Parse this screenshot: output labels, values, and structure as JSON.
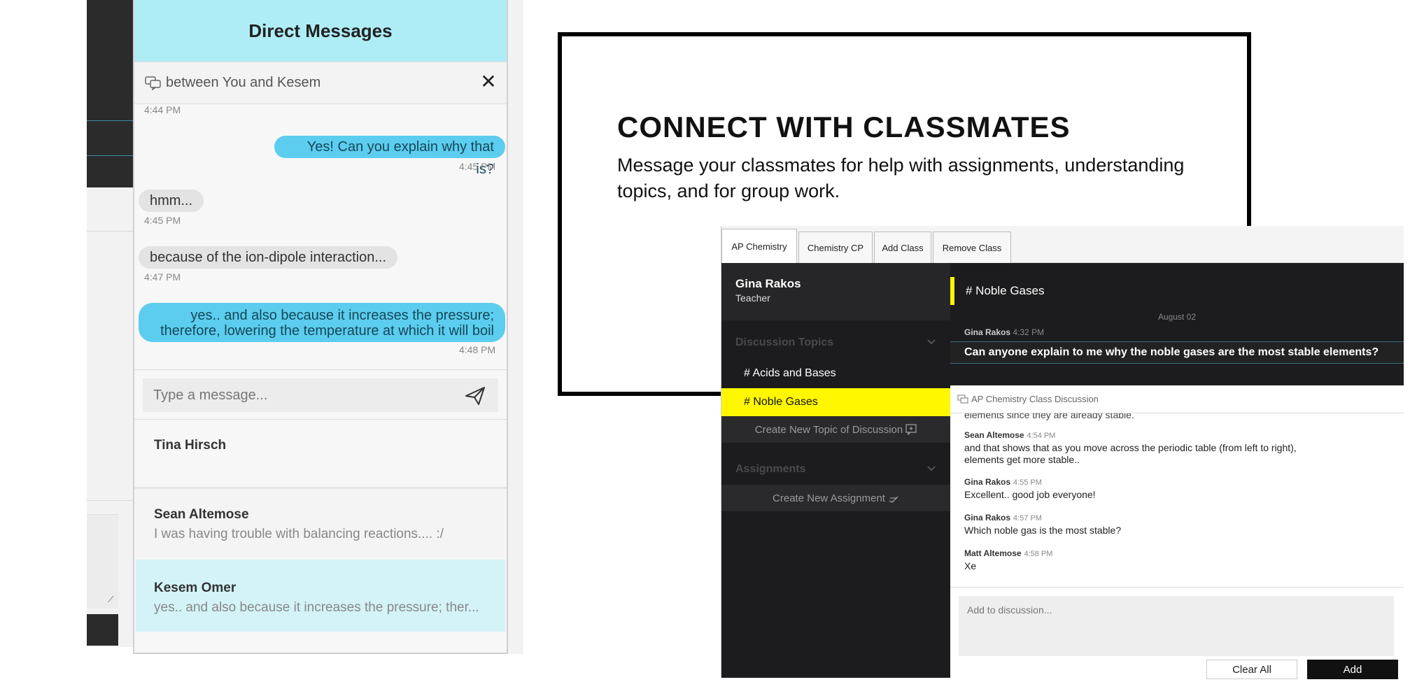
{
  "dm": {
    "title": "Direct Messages",
    "subtitle": "between You and Kesem",
    "messages": [
      {
        "time": "4:44 PM"
      },
      {
        "text": "Yes! Can you explain why that is?",
        "time": "4:45 PM",
        "from": "me"
      },
      {
        "text": "hmm...",
        "time": "4:45 PM",
        "from": "them"
      },
      {
        "text": "because of the ion-dipole interaction...",
        "time": "4:47 PM",
        "from": "them"
      },
      {
        "text_line1": "yes.. and also because it increases the pressure;",
        "text_line2": "therefore, lowering the temperature at which it will boil",
        "time": "4:48 PM",
        "from": "me"
      }
    ],
    "compose_placeholder": "Type a message...",
    "contacts": [
      {
        "name": "Tina Hirsch",
        "preview": ""
      },
      {
        "name": "Sean Altemose",
        "preview": "I was having trouble with balancing reactions.... :/"
      },
      {
        "name": "Kesem Omer",
        "preview": "yes.. and also because it increases the pressure; ther..."
      }
    ],
    "colors": {
      "header": "#aeedf6",
      "my_bubble": "#5ccdee",
      "selected_contact": "#d3f3f7"
    }
  },
  "promo": {
    "headline": "CONNECT WITH CLASSMATES",
    "body": "Message your classmates for help with assignments, understanding topics, and for group work."
  },
  "app": {
    "tabs": [
      "AP Chemistry",
      "Chemistry CP",
      "Add Class",
      "Remove Class"
    ],
    "profile": {
      "name": "Gina Rakos",
      "role": "Teacher"
    },
    "sections": {
      "discussion": "Discussion Topics",
      "assignments": "Assignments"
    },
    "topics": [
      "# Acids and Bases",
      "# Noble Gases"
    ],
    "create_topic": "Create New Topic of Discussion",
    "create_assignment": "Create New Assignment",
    "channel": "# Noble Gases",
    "date": "August 02",
    "question_author": "Gina Rakos",
    "question_time": "4:32 PM",
    "question": "Can anyone explain to me why the noble gases are the most stable elements?",
    "discussion_title": "AP Chemistry Class Discussion",
    "cut_text": "elements since they are already stable.",
    "posts": [
      {
        "author": "Sean Altemose",
        "time": "4:54 PM",
        "line1": "and that shows that as you move across the periodic table (from left to right),",
        "line2": "elements get more stable.."
      },
      {
        "author": "Gina Rakos",
        "time": "4:55 PM",
        "line1": "Excellent.. good job everyone!"
      },
      {
        "author": "Gina Rakos",
        "time": "4:57 PM",
        "line1": "Which noble gas is the most stable?"
      },
      {
        "author": "Matt Altemose",
        "time": "4:58 PM",
        "line1": "Xe"
      }
    ],
    "add_placeholder": "Add to discussion...",
    "clear_label": "Clear All",
    "add_label": "Add",
    "colors": {
      "highlight": "#fff700",
      "sidebar": "#1c1c1e"
    }
  }
}
